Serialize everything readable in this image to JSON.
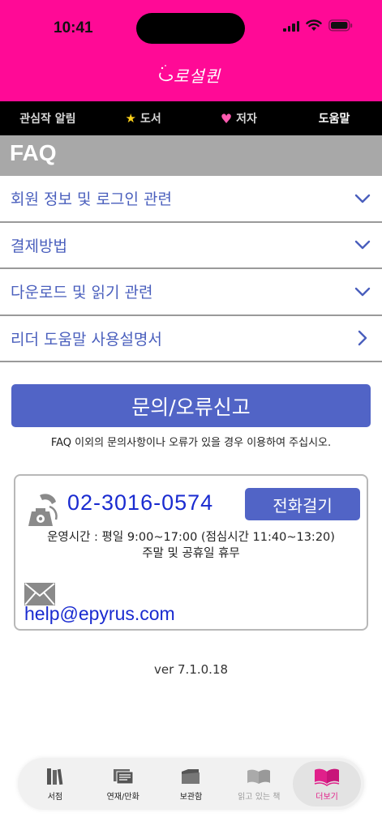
{
  "status": {
    "time": "10:41"
  },
  "brand": {
    "logo_text": "로설퀸"
  },
  "tabs": [
    {
      "label": "관심작 알림",
      "icon": ""
    },
    {
      "label": "도서",
      "icon": "star-icon"
    },
    {
      "label": "저자",
      "icon": "heart-icon"
    },
    {
      "label": "도움말",
      "icon": "",
      "active": true
    }
  ],
  "faq": {
    "title": "FAQ",
    "items": [
      {
        "label": "회원 정보 및 로그인 관련",
        "icon": "chevron-down-icon"
      },
      {
        "label": "결제방법",
        "icon": "chevron-down-icon"
      },
      {
        "label": "다운로드 및 읽기 관련",
        "icon": "chevron-down-icon"
      },
      {
        "label": "리더 도움말 사용설명서",
        "icon": "chevron-right-icon"
      }
    ]
  },
  "inquiry": {
    "button_label": "문의/오류신고",
    "note": "FAQ 이외의 문의사항이나 오류가 있을 경우 이용하여 주십시오."
  },
  "contact": {
    "phone": "02-3016-0574",
    "call_label": "전화걸기",
    "hours_line1": "운영시간 : 평일 9:00~17:00 (점심시간 11:40~13:20)",
    "hours_line2": "주말 및 공휴일 휴무",
    "email": "help@epyrus.com"
  },
  "version": "ver 7.1.0.18",
  "bottom_nav": [
    {
      "label": "서점",
      "icon": "bookshelf-icon"
    },
    {
      "label": "연재/만화",
      "icon": "serial-icon"
    },
    {
      "label": "보관함",
      "icon": "folder-icon"
    },
    {
      "label": "읽고 있는 책",
      "icon": "open-book-icon",
      "disabled": true
    },
    {
      "label": "더보기",
      "icon": "more-book-icon",
      "active": true
    }
  ],
  "colors": {
    "header": "#ff0a96",
    "accent": "#5164c6",
    "link_blue": "#1a2bd0",
    "faq_text": "#4a5fbd",
    "active_nav": "#e0208a"
  }
}
